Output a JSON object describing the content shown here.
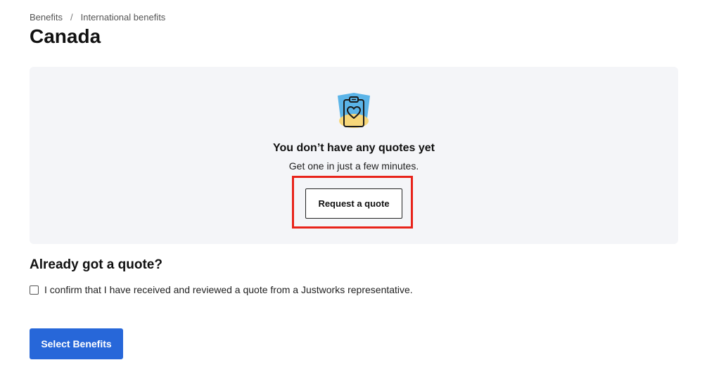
{
  "breadcrumb": {
    "items": [
      "Benefits",
      "International benefits"
    ],
    "separator": "/"
  },
  "page": {
    "title": "Canada"
  },
  "empty_state": {
    "icon": "clipboard-heart-icon",
    "title": "You don’t have any quotes yet",
    "subtitle": "Get one in just a few minutes.",
    "button_label": "Request a quote"
  },
  "confirm": {
    "heading": "Already got a quote?",
    "checkbox_label": "I confirm that I have received and reviewed a quote from a Justworks representative.",
    "checked": false
  },
  "footer": {
    "primary_label": "Select Benefits"
  },
  "colors": {
    "primary": "#2767d9",
    "highlight": "#e8231a",
    "card_bg": "#f4f5f8",
    "illustration_blue": "#5bb4e8",
    "illustration_yellow": "#f7d77a"
  }
}
